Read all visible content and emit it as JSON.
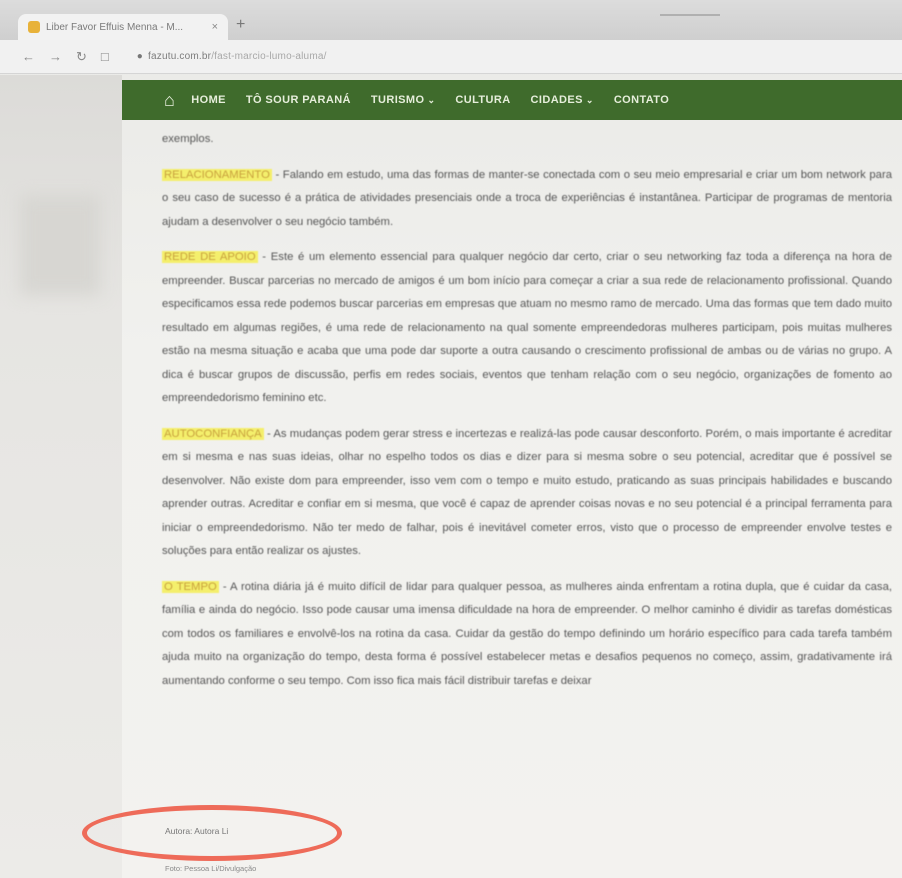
{
  "browser": {
    "tab_title": "Liber Favor Effuis Menna - M...",
    "tab_close": "×",
    "new_tab": "+",
    "url_host": "fazutu.com.br",
    "url_path": "/fast-marcio-lumo-aluma/"
  },
  "nav": {
    "home_icon": "home-icon",
    "items": [
      {
        "label": "HOME",
        "has_dropdown": false
      },
      {
        "label": "TÔ SOUR PARANÁ",
        "has_dropdown": false
      },
      {
        "label": "TURISMO",
        "has_dropdown": true
      },
      {
        "label": "CULTURA",
        "has_dropdown": false
      },
      {
        "label": "CIDADES",
        "has_dropdown": true
      },
      {
        "label": "CONTATO",
        "has_dropdown": false
      }
    ],
    "color": "#3f6b2c"
  },
  "article": {
    "intro": "exemplos.",
    "sections": [
      {
        "heading": "RELACIONAMENTO",
        "text": " - Falando em estudo, uma das formas de manter-se conectada com o seu meio empresarial e criar um bom network para o seu caso de sucesso é a prática de atividades presenciais onde a troca de experiências é instantânea. Participar de programas de mentoria ajudam a desenvolver o seu negócio também."
      },
      {
        "heading": "REDE DE APOIO",
        "text": " - Este é um elemento essencial para qualquer negócio dar certo, criar o seu networking faz toda a diferença na hora de empreender. Buscar parcerias no mercado de amigos é um bom início para começar a criar a sua rede de relacionamento profissional. Quando especificamos essa rede podemos buscar parcerias em empresas que atuam no mesmo ramo de mercado. Uma das formas que tem dado muito resultado em algumas regiões, é uma rede de relacionamento na qual somente empreendedoras mulheres participam, pois muitas mulheres estão na mesma situação e acaba que uma pode dar suporte a outra causando o crescimento profissional de ambas ou de várias no grupo. A dica é buscar grupos de discussão, perfis em redes sociais, eventos que tenham relação com o seu negócio, organizações de fomento ao empreendedorismo feminino etc."
      },
      {
        "heading": "AUTOCONFIANÇA",
        "text": " - As mudanças podem gerar stress e incertezas e realizá-las pode causar desconforto. Porém, o mais importante é acreditar em si mesma e nas suas ideias, olhar no espelho todos os dias e dizer para si mesma sobre o seu potencial, acreditar que é possível se desenvolver. Não existe dom para empreender, isso vem com o tempo e muito estudo, praticando as suas principais habilidades e buscando aprender outras. Acreditar e confiar em si mesma, que você é capaz de aprender coisas novas e no seu potencial é a principal ferramenta para iniciar o empreendedorismo. Não ter medo de falhar, pois é inevitável cometer erros, visto que o processo de empreender envolve testes e soluções para então realizar os ajustes."
      },
      {
        "heading": "O TEMPO",
        "text": " - A rotina diária já é muito difícil de lidar para qualquer pessoa, as mulheres ainda enfrentam a rotina dupla, que é cuidar da casa, família e ainda do negócio. Isso pode causar uma imensa dificuldade na hora de empreender. O melhor caminho é dividir as tarefas domésticas com todos os familiares e envolvê-los na rotina da casa. Cuidar da gestão do tempo definindo um horário específico para cada tarefa também ajuda muito na organização do tempo, desta forma é possível estabelecer metas e desafios pequenos no começo, assim, gradativamente irá aumentando conforme o seu tempo. Com isso fica mais fácil distribuir tarefas e deixar"
      }
    ],
    "highlight_color": "#f4ef6c"
  },
  "footer": {
    "circled_link": "Autora: Autora Li",
    "next_link": "Foto: Pessoa Li/Divulgação"
  },
  "annotation": {
    "circle_color": "#ee6b59"
  }
}
